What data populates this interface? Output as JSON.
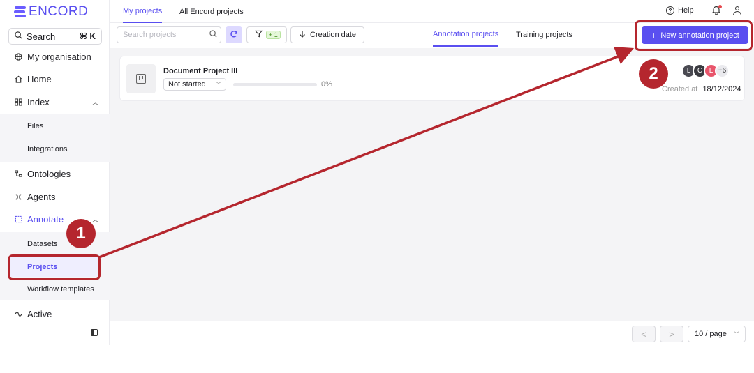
{
  "brand": {
    "logo_text": "ENCORD"
  },
  "sidebar": {
    "search_label": "Search",
    "search_shortcut": "⌘ K",
    "items": [
      {
        "label": "My organisation",
        "icon": "globe-icon"
      },
      {
        "label": "Home",
        "icon": "home-icon"
      },
      {
        "label": "Index",
        "icon": "grid-icon"
      },
      {
        "label": "Files"
      },
      {
        "label": "Integrations"
      },
      {
        "label": "Ontologies",
        "icon": "ontology-icon"
      },
      {
        "label": "Agents",
        "icon": "agents-icon"
      },
      {
        "label": "Annotate",
        "icon": "annotate-icon"
      },
      {
        "label": "Datasets"
      },
      {
        "label": "Projects"
      },
      {
        "label": "Workflow templates"
      },
      {
        "label": "Active",
        "icon": "active-icon"
      }
    ]
  },
  "topbar": {
    "tabs": [
      "My projects",
      "All Encord projects"
    ],
    "help_label": "Help"
  },
  "toolbar": {
    "search_placeholder": "Search projects",
    "filter_badge": "+ 1",
    "sort_label": "Creation date",
    "project_tabs": [
      "Annotation projects",
      "Training projects"
    ],
    "new_button_label": "New annotation project"
  },
  "projects": [
    {
      "title": "Document Project III",
      "status": "Not started",
      "progress_percent": 0,
      "progress_label": "0%",
      "avatars": [
        {
          "letter": "L",
          "color": "#4a4a52"
        },
        {
          "letter": "C",
          "color": "#3a3a40"
        },
        {
          "letter": "L",
          "color": "#e8556b"
        }
      ],
      "more_count": "+6",
      "created_label": "Created at",
      "created_date": "18/12/2024"
    }
  ],
  "pagination": {
    "per_page": "10 / page",
    "prev": "<",
    "next": ">"
  },
  "annotations": {
    "step1": "1",
    "step2": "2",
    "color": "#b5262e"
  },
  "colors": {
    "accent": "#5a4ff0",
    "annotation": "#b5262e"
  }
}
